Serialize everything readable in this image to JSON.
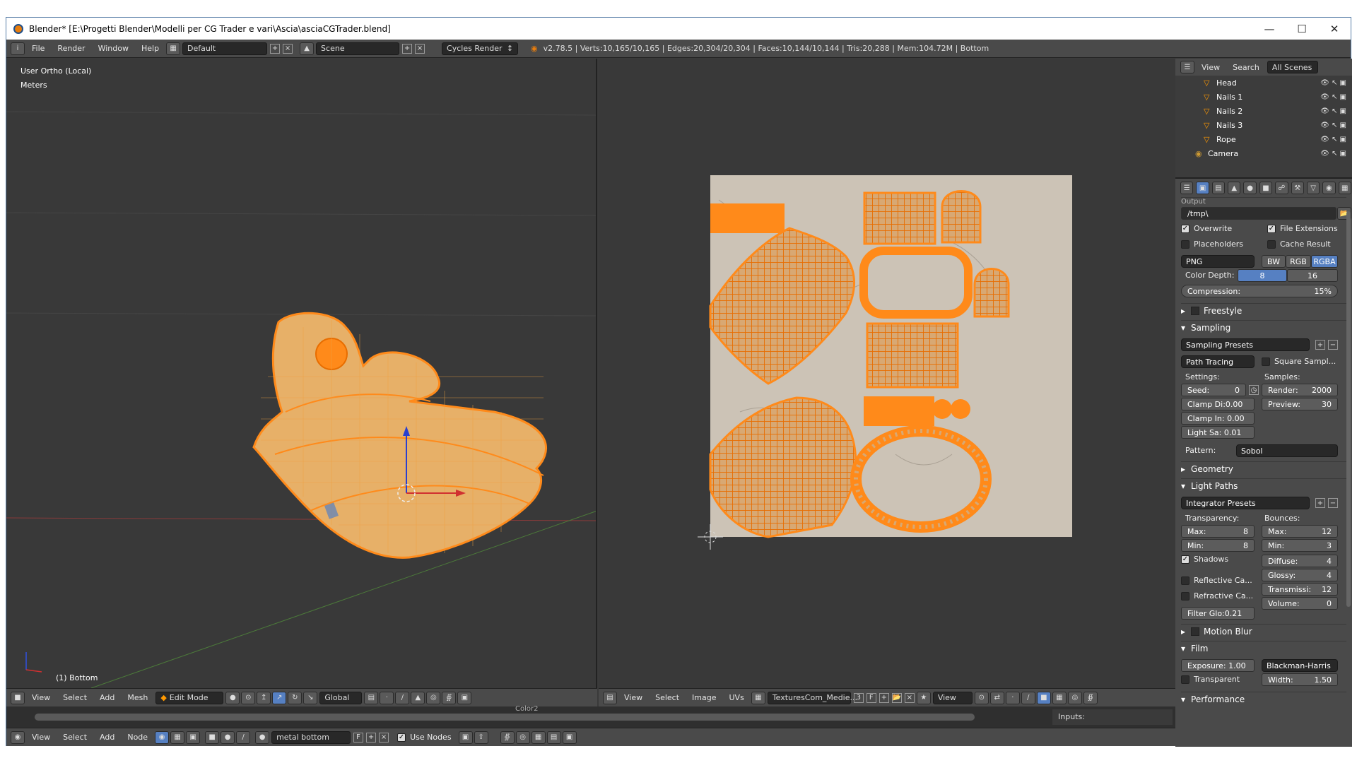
{
  "window": {
    "title": "Blender* [E:\\Progetti Blender\\Modelli per CG Trader e vari\\Ascia\\asciaCGTrader.blend]"
  },
  "menu": [
    "File",
    "Render",
    "Window",
    "Help"
  ],
  "layout": "Default",
  "scene": "Scene",
  "engine": "Cycles Render",
  "stats": "v2.78.5 | Verts:10,165/10,165 | Edges:20,304/20,304 | Faces:10,144/10,144 | Tris:20,288 | Mem:104.72M | Bottom",
  "viewport": {
    "view_name": "User Ortho (Local)",
    "units": "Meters",
    "object_label": "(1) Bottom",
    "header": {
      "view": "View",
      "select": "Select",
      "add": "Add",
      "mesh": "Mesh",
      "mode": "Edit Mode",
      "orientation": "Global"
    }
  },
  "uv_editor": {
    "header": {
      "view": "View",
      "select": "Select",
      "image": "Image",
      "uvs": "UVs",
      "image_name": "TexturesCom_Medie...",
      "users": "3",
      "fake": "F",
      "view2": "View"
    }
  },
  "node_editor": {
    "header": {
      "view": "View",
      "select": "Select",
      "add": "Add",
      "node": "Node",
      "material": "metal bottom",
      "fake": "F",
      "use_nodes": "Use Nodes"
    },
    "inputs_label": "Inputs:",
    "color_label": "Color2"
  },
  "outliner": {
    "header": {
      "view": "View",
      "search": "Search",
      "filter": "All Scenes"
    },
    "items": [
      "Head",
      "Nails 1",
      "Nails 2",
      "Nails 3",
      "Rope",
      "Camera"
    ]
  },
  "properties": {
    "output": {
      "section": "Output",
      "path": "/tmp\\",
      "overwrite": "Overwrite",
      "file_extensions": "File Extensions",
      "placeholders": "Placeholders",
      "cache_result": "Cache Result",
      "format": "PNG",
      "bw": "BW",
      "rgb": "RGB",
      "rgba": "RGBA",
      "color_depth_label": "Color Depth:",
      "depth_8": "8",
      "depth_16": "16",
      "compression": "Compression:",
      "compression_value": "15%"
    },
    "freestyle": "Freestyle",
    "sampling": {
      "section": "Sampling",
      "presets": "Sampling Presets",
      "method": "Path Tracing",
      "square_samples": "Square Sampl...",
      "settings_label": "Settings:",
      "samples_label": "Samples:",
      "seed": "Seed:",
      "seed_value": "0",
      "clamp_direct": "Clamp Di:0.00",
      "clamp_indirect": "Clamp In: 0.00",
      "light_sampling": "Light Sa: 0.01",
      "render": "Render:",
      "render_value": "2000",
      "preview": "Preview:",
      "preview_value": "30",
      "pattern_label": "Pattern:",
      "pattern": "Sobol"
    },
    "geometry": "Geometry",
    "light_paths": {
      "section": "Light Paths",
      "presets": "Integrator Presets",
      "transparency_label": "Transparency:",
      "bounces_label": "Bounces:",
      "t_max": "Max:",
      "t_max_value": "8",
      "t_min": "Min:",
      "t_min_value": "8",
      "shadows": "Shadows",
      "reflective": "Reflective Ca...",
      "refractive": "Refractive Ca...",
      "filter_glossy": "Filter Glo:0.21",
      "b_max": "Max:",
      "b_max_value": "12",
      "b_min": "Min:",
      "b_min_value": "3",
      "diffuse": "Diffuse:",
      "diffuse_value": "4",
      "glossy": "Glossy:",
      "glossy_value": "4",
      "transmission": "Transmissi:",
      "transmission_value": "12",
      "volume": "Volume:",
      "volume_value": "0"
    },
    "motion_blur": "Motion Blur",
    "film": {
      "section": "Film",
      "exposure": "Exposure: 1.00",
      "filter": "Blackman-Harris",
      "transparent": "Transparent",
      "width": "Width:",
      "width_value": "1.50"
    },
    "performance": "Performance"
  },
  "colors": {
    "accent": "#ff8a1a",
    "mesh_fill": "#e7b068",
    "selected_blue": "#5680c2"
  }
}
